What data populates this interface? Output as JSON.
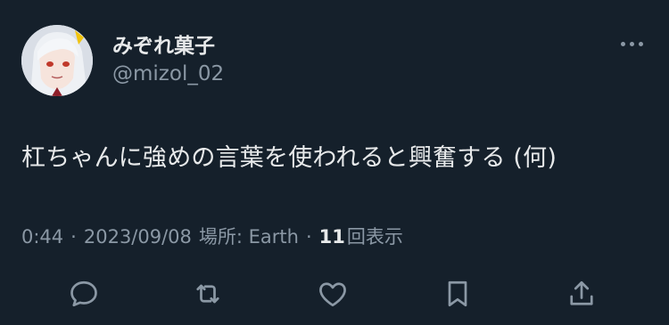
{
  "tweet": {
    "author": {
      "display_name": "みぞれ菓子",
      "handle": "@mizol_02",
      "avatar_icon": "avatar-anime-girl"
    },
    "text": "杠ちゃんに強めの言葉を使われると興奮する (何)",
    "meta": {
      "time": "0:44",
      "separator": "·",
      "date": "2023/09/08",
      "location_label": "場所: Earth",
      "views_count": "11",
      "views_label": "回表示"
    },
    "actions": [
      {
        "name": "reply",
        "icon": "speech-bubble-icon"
      },
      {
        "name": "retweet",
        "icon": "retweet-icon"
      },
      {
        "name": "like",
        "icon": "heart-icon"
      },
      {
        "name": "bookmark",
        "icon": "bookmark-icon"
      },
      {
        "name": "share",
        "icon": "share-icon"
      }
    ]
  },
  "colors": {
    "background": "#15202b",
    "primary_text": "#e7e9ea",
    "secondary_text": "#8b98a5"
  }
}
